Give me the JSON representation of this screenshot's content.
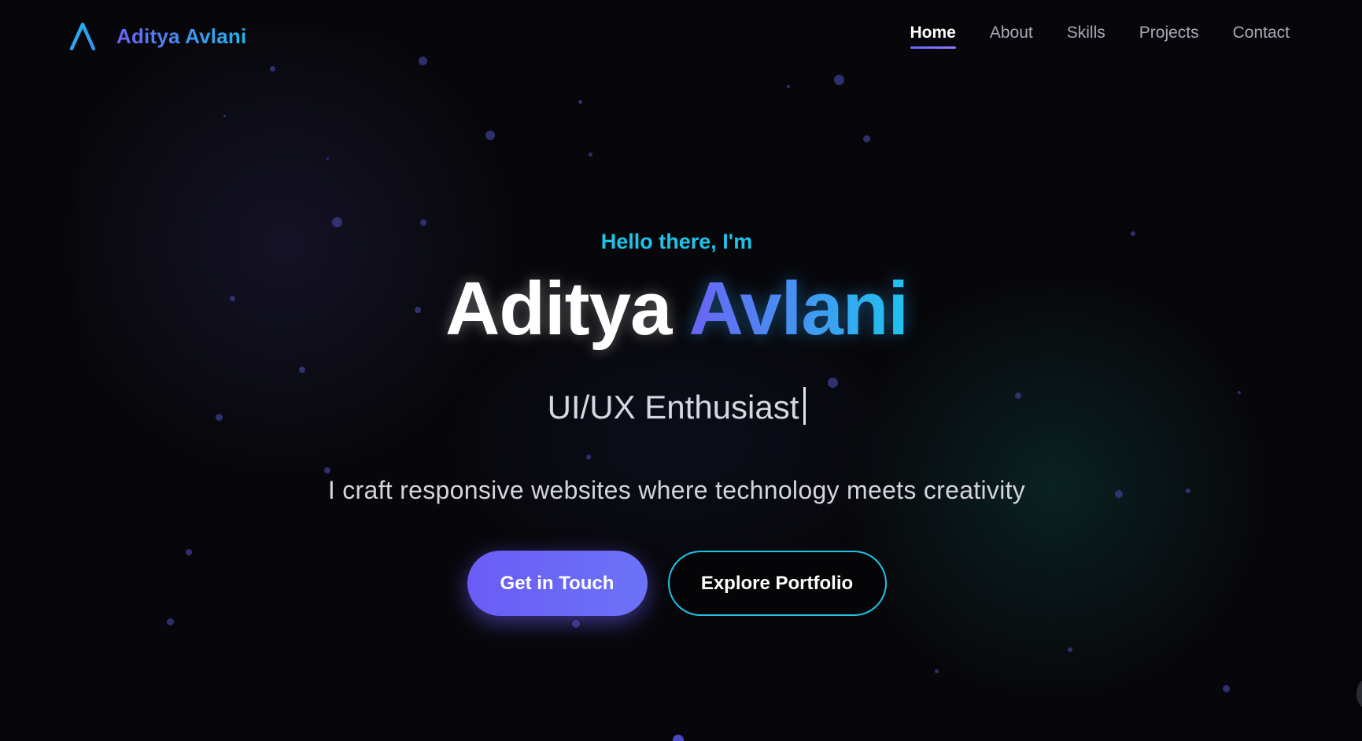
{
  "header": {
    "logo_text": "Aditya Avlani",
    "logo_icon": "logo-a-icon",
    "nav": [
      {
        "label": "Home",
        "active": true
      },
      {
        "label": "About",
        "active": false
      },
      {
        "label": "Skills",
        "active": false
      },
      {
        "label": "Projects",
        "active": false
      },
      {
        "label": "Contact",
        "active": false
      }
    ]
  },
  "hero": {
    "greeting": "Hello there, I'm",
    "name_first": "Aditya",
    "name_last": "Avlani",
    "role": "UI/UX Enthusiast",
    "tagline": "I craft responsive websites where technology meets creativity",
    "primary_button": "Get in Touch",
    "secondary_button": "Explore Portfolio"
  },
  "colors": {
    "background": "#060608",
    "accent_purple": "#6a5cf6",
    "accent_cyan": "#1ec3e6",
    "nav_inactive": "#a9aab6",
    "text_light": "#d3d4dc"
  }
}
